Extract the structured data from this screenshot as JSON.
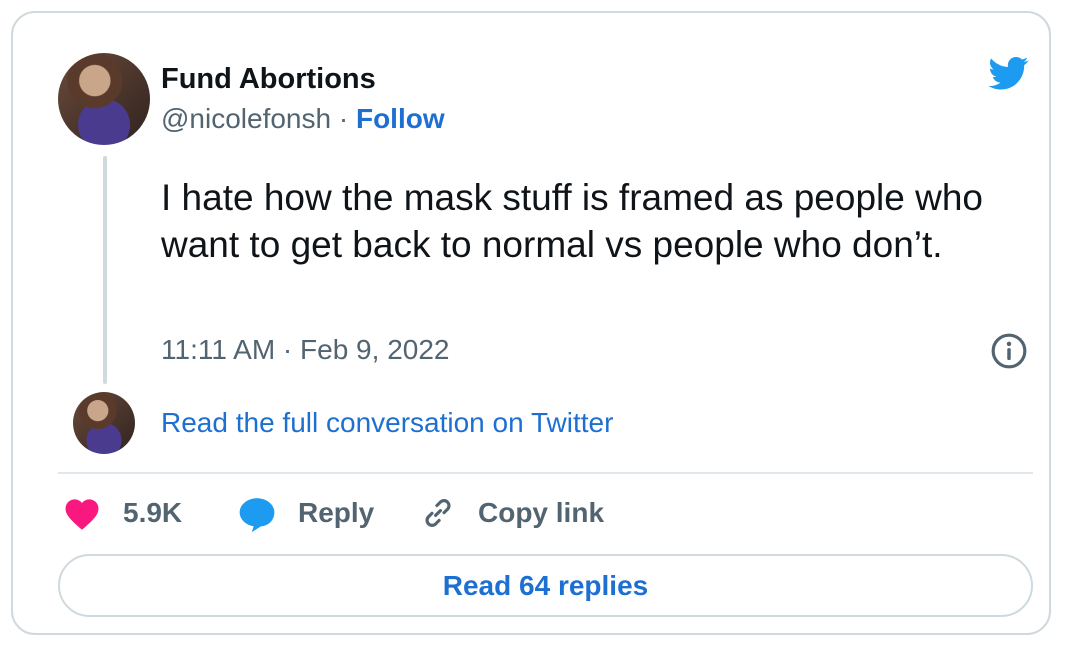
{
  "author": {
    "display_name": "Fund Abortions",
    "handle": "@nicolefonsh",
    "separator": " · ",
    "follow_label": "Follow"
  },
  "tweet": {
    "text": "I hate how the mask stuff is framed as people who want to get back to normal vs people who don’t.",
    "timestamp": "11:11 AM · Feb 9, 2022"
  },
  "conversation": {
    "read_full_label": "Read the full conversation on Twitter"
  },
  "actions": {
    "like_count": "5.9K",
    "reply_label": "Reply",
    "copy_link_label": "Copy link"
  },
  "footer": {
    "read_replies_label": "Read 64 replies"
  },
  "icons": {
    "brand": "twitter-bird-icon",
    "info": "info-icon",
    "like": "heart-icon",
    "reply": "speech-bubble-icon",
    "copy": "link-icon"
  },
  "colors": {
    "twitter_blue": "#1d9bf0",
    "link_blue": "#1d6fd1",
    "heart_pink": "#f91880",
    "secondary_text": "#536471",
    "border": "#cfd9de"
  }
}
